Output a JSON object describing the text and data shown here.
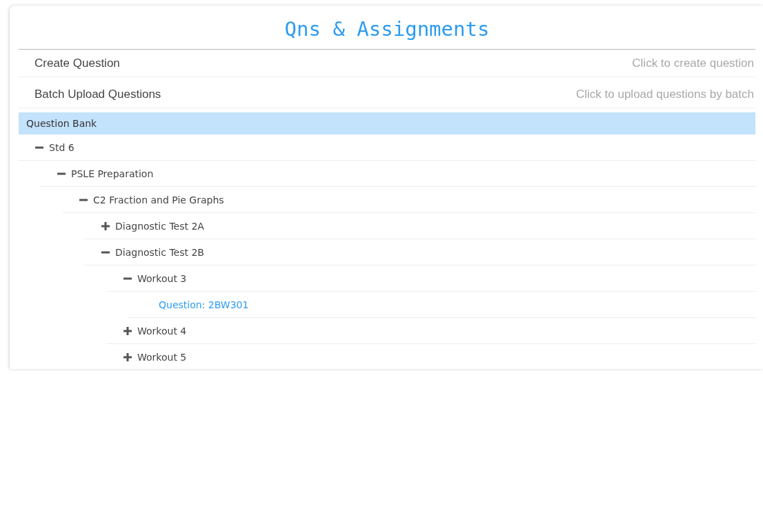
{
  "title": "Qns & Assignments",
  "actions": [
    {
      "label": "Create Question",
      "hint": "Click to create question"
    },
    {
      "label": "Batch Upload Questions",
      "hint": "Click to upload questions by batch"
    }
  ],
  "bank": {
    "label": "Question Bank",
    "selected": true,
    "tree": [
      {
        "kind": "folder",
        "label": "Std 6",
        "expanded": true,
        "children": [
          {
            "kind": "folder",
            "label": "PSLE Preparation",
            "expanded": true,
            "children": [
              {
                "kind": "folder",
                "label": "C2 Fraction and Pie Graphs",
                "expanded": true,
                "children": [
                  {
                    "kind": "folder",
                    "label": "Diagnostic Test 2A",
                    "expanded": false
                  },
                  {
                    "kind": "folder",
                    "label": "Diagnostic Test 2B",
                    "expanded": true,
                    "children": [
                      {
                        "kind": "folder",
                        "label": "Workout 3",
                        "expanded": true,
                        "children": [
                          {
                            "kind": "question",
                            "label": "Question: 2BW301"
                          }
                        ]
                      },
                      {
                        "kind": "folder",
                        "label": "Workout 4",
                        "expanded": false
                      },
                      {
                        "kind": "folder",
                        "label": "Workout 5",
                        "expanded": false
                      }
                    ]
                  }
                ]
              }
            ]
          }
        ]
      }
    ]
  }
}
